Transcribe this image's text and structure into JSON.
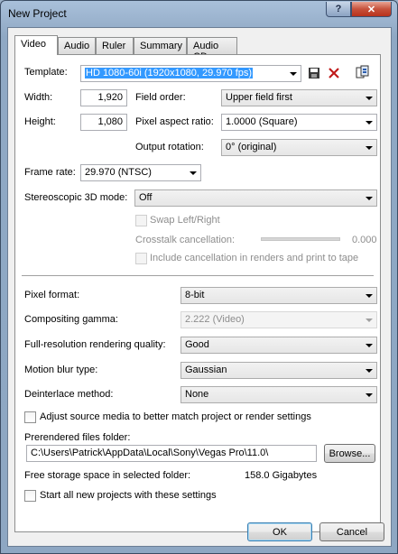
{
  "window": {
    "title": "New Project",
    "help_glyph": "?",
    "close_glyph": "✕"
  },
  "tabs": [
    "Video",
    "Audio",
    "Ruler",
    "Summary",
    "Audio CD"
  ],
  "video": {
    "template_label": "Template:",
    "template_value": "HD 1080-60i (1920x1080, 29.970 fps)",
    "width_label": "Width:",
    "width_value": "1,920",
    "height_label": "Height:",
    "height_value": "1,080",
    "field_order_label": "Field order:",
    "field_order_value": "Upper field first",
    "pixel_aspect_label": "Pixel aspect ratio:",
    "pixel_aspect_value": "1.0000 (Square)",
    "output_rotation_label": "Output rotation:",
    "output_rotation_value": "0° (original)",
    "frame_rate_label": "Frame rate:",
    "frame_rate_value": "29.970 (NTSC)",
    "stereo_label": "Stereoscopic 3D mode:",
    "stereo_value": "Off",
    "swap_label": "Swap Left/Right",
    "crosstalk_label": "Crosstalk cancellation:",
    "crosstalk_value": "0.000",
    "include_cancel_label": "Include cancellation in renders and print to tape",
    "pixel_format_label": "Pixel format:",
    "pixel_format_value": "8-bit",
    "gamma_label": "Compositing gamma:",
    "gamma_value": "2.222 (Video)",
    "quality_label": "Full-resolution rendering quality:",
    "quality_value": "Good",
    "motion_blur_label": "Motion blur type:",
    "motion_blur_value": "Gaussian",
    "deinterlace_label": "Deinterlace method:",
    "deinterlace_value": "None",
    "adjust_label": "Adjust source media to better match project or render settings",
    "prerendered_label": "Prerendered files folder:",
    "prerendered_value": "C:\\Users\\Patrick\\AppData\\Local\\Sony\\Vegas Pro\\11.0\\",
    "browse_label": "Browse...",
    "free_storage_label": "Free storage space in selected folder:",
    "free_storage_value": "158.0 Gigabytes",
    "start_all_label": "Start all new projects with these settings"
  },
  "buttons": {
    "ok": "OK",
    "cancel": "Cancel"
  },
  "colors": {
    "selection": "#3399ff",
    "close_button": "#c7523c"
  }
}
